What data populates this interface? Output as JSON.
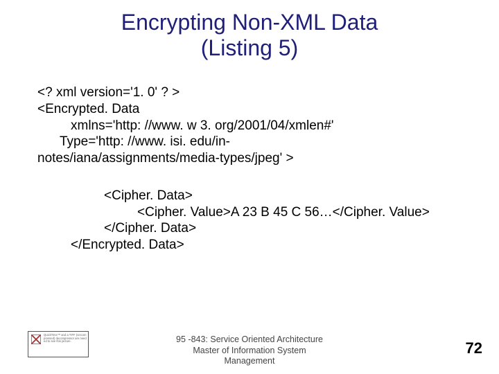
{
  "title_line1": "Encrypting Non-XML Data",
  "title_line2": "(Listing 5)",
  "lines": {
    "l0": "<? xml version='1. 0' ? >",
    "l1": "<Encrypted. Data",
    "l2": "xmlns='http: //www. w 3. org/2001/04/xmlen#'",
    "l3": "Type='http: //www. isi. edu/in-",
    "l4": "notes/iana/assignments/media-types/jpeg' >",
    "l5": "<Cipher. Data>",
    "l6": "<Cipher. Value>A 23 B 45 C 56…</Cipher. Value>",
    "l7": "</Cipher. Data>",
    "l8": "</Encrypted. Data>"
  },
  "footer": {
    "course": "95 -843: Service Oriented Architecture",
    "dept1": "Master of Information System",
    "dept2": "Management"
  },
  "page_number": "72",
  "placeholder_caption": "QuickTime™ and a TIFF (Uncompressed) decompressor are needed to see this picture."
}
